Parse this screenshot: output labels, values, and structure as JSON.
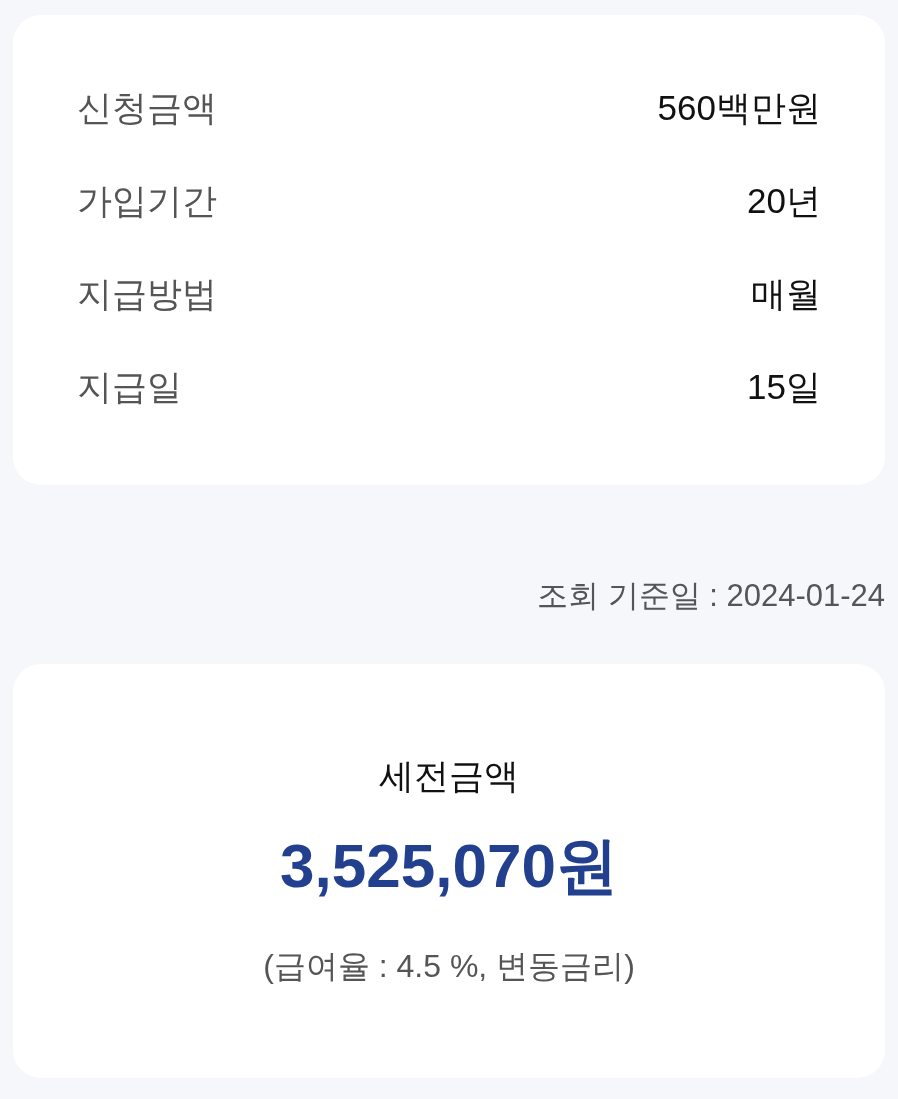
{
  "details": {
    "rows": [
      {
        "label": "신청금액",
        "value": "560백만원"
      },
      {
        "label": "가입기간",
        "value": "20년"
      },
      {
        "label": "지급방법",
        "value": "매월"
      },
      {
        "label": "지급일",
        "value": "15일"
      }
    ]
  },
  "inquiry_date": "조회 기준일 : 2024-01-24",
  "summary": {
    "title": "세전금액",
    "amount": "3,525,070원",
    "note": "(급여율 : 4.5 %, 변동금리)"
  }
}
